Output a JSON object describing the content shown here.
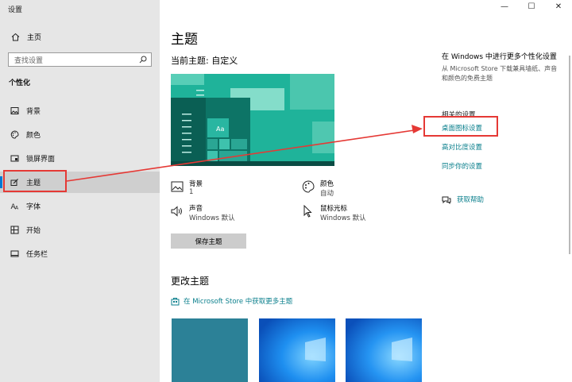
{
  "window": {
    "title": "设置",
    "controls": [
      "—",
      "☐",
      "✕"
    ]
  },
  "sidebar": {
    "home_label": "主页",
    "search_placeholder": "查找设置",
    "section_label": "个性化",
    "items": [
      {
        "label": "背景",
        "icon": "image-icon"
      },
      {
        "label": "颜色",
        "icon": "palette-icon"
      },
      {
        "label": "锁屏界面",
        "icon": "lock-screen-icon"
      },
      {
        "label": "主题",
        "icon": "theme-icon",
        "selected": true
      },
      {
        "label": "字体",
        "icon": "font-icon"
      },
      {
        "label": "开始",
        "icon": "start-icon"
      },
      {
        "label": "任务栏",
        "icon": "taskbar-icon"
      }
    ]
  },
  "main": {
    "title": "主题",
    "current_theme_label": "当前主题: 自定义",
    "attributes": {
      "background": {
        "name": "背景",
        "value": "1"
      },
      "color": {
        "name": "颜色",
        "value": "自动"
      },
      "sound": {
        "name": "声音",
        "value": "Windows 默认"
      },
      "cursor": {
        "name": "鼠标光标",
        "value": "Windows 默认"
      }
    },
    "save_button": "保存主题",
    "change_theme_title": "更改主题",
    "store_link": "在 Microsoft Store 中获取更多主题",
    "preview_tile_text": "Aa"
  },
  "right_panel": {
    "heading": "在 Windows 中进行更多个性化设置",
    "description": "从 Microsoft Store 下载兼具墙纸、声音和颜色的免费主题",
    "related_title": "相关的设置",
    "links": [
      "桌面图标设置",
      "高对比度设置",
      "同步你的设置"
    ],
    "help": "获取帮助"
  },
  "colors": {
    "accent": "#0078d4",
    "link": "#0a7f8c",
    "annotation": "#e53935",
    "preview_teal": "#1fb39a"
  }
}
